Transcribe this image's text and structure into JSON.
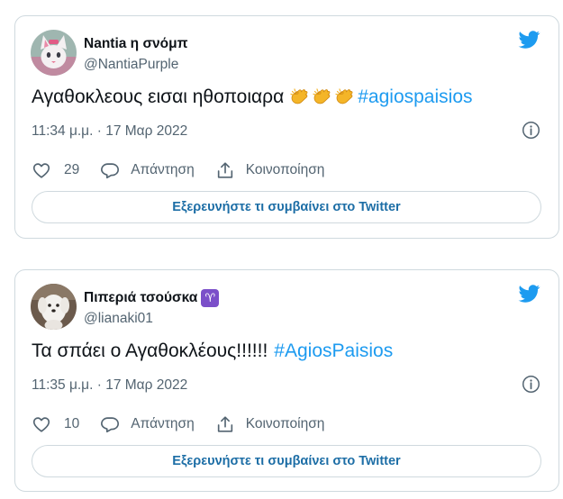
{
  "colors": {
    "accent": "#1d9bf0",
    "secondary_text": "#536471",
    "border": "#cfd9de",
    "aries_badge": "#7b4fc9"
  },
  "tweets": [
    {
      "display_name": "Nantia η σνόμπ",
      "handle": "@NantiaPurple",
      "text": "Αγαθοκλεους εισαι ηθοποιαρα",
      "emoji": [
        "clapping-hands",
        "clapping-hands",
        "clapping-hands"
      ],
      "hashtag": "#agiospaisios",
      "timestamp": "11:34 μ.μ. · 17 Μαρ 2022",
      "like_count": "29",
      "reply_label": "Απάντηση",
      "share_label": "Κοινοποίηση",
      "explore_label": "Εξερευνήστε τι συμβαίνει στο Twitter"
    },
    {
      "display_name": "Πιπεριά τσούσκα",
      "badge": "♈",
      "handle": "@lianaki01",
      "text": "Τα σπάει ο Αγαθοκλέους!!!!!!",
      "hashtag": "#AgiosPaisios",
      "timestamp": "11:35 μ.μ. · 17 Μαρ 2022",
      "like_count": "10",
      "reply_label": "Απάντηση",
      "share_label": "Κοινοποίηση",
      "explore_label": "Εξερευνήστε τι συμβαίνει στο Twitter"
    }
  ]
}
